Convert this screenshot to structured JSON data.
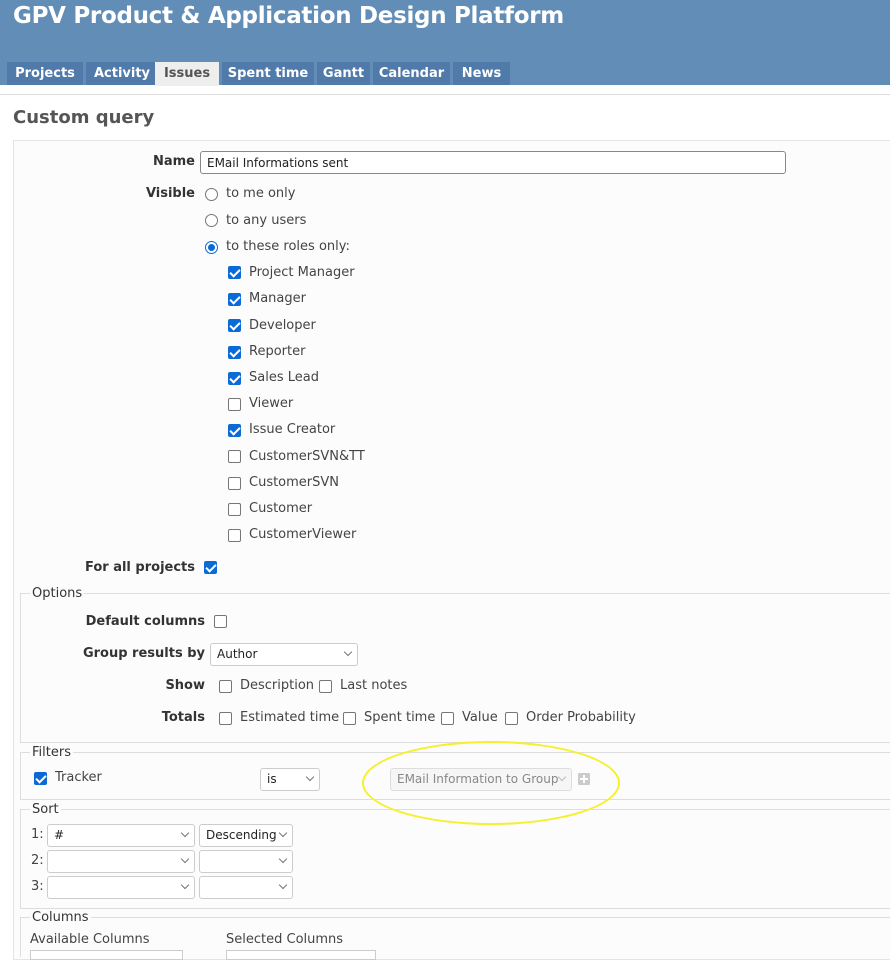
{
  "app": {
    "title": "GPV Product & Application Design Platform"
  },
  "menu": {
    "tabs": [
      {
        "label": "Projects"
      },
      {
        "label": "Activity"
      },
      {
        "label": "Issues",
        "selected": true
      },
      {
        "label": "Spent time"
      },
      {
        "label": "Gantt"
      },
      {
        "label": "Calendar"
      },
      {
        "label": "News"
      }
    ]
  },
  "page": {
    "title": "Custom query"
  },
  "form": {
    "name_label": "Name",
    "name_value": "EMail Informations sent",
    "visible_label": "Visible",
    "visibility_options": [
      {
        "label": "to me only",
        "checked": false
      },
      {
        "label": "to any users",
        "checked": false
      },
      {
        "label": "to these roles only:",
        "checked": true
      }
    ],
    "roles": [
      {
        "label": "Project Manager",
        "checked": true
      },
      {
        "label": "Manager",
        "checked": true
      },
      {
        "label": "Developer",
        "checked": true
      },
      {
        "label": "Reporter",
        "checked": true
      },
      {
        "label": "Sales Lead",
        "checked": true
      },
      {
        "label": "Viewer",
        "checked": false
      },
      {
        "label": "Issue Creator",
        "checked": true
      },
      {
        "label": "CustomerSVN&TT",
        "checked": false
      },
      {
        "label": "CustomerSVN",
        "checked": false
      },
      {
        "label": "Customer",
        "checked": false
      },
      {
        "label": "CustomerViewer",
        "checked": false
      }
    ],
    "all_projects_label": "For all projects",
    "all_projects_checked": true
  },
  "options": {
    "legend": "Options",
    "default_columns_label": "Default columns",
    "group_by_label": "Group results by",
    "group_by_value": "Author",
    "show_label": "Show",
    "show_items": [
      {
        "label": "Description"
      },
      {
        "label": "Last notes"
      }
    ],
    "totals_label": "Totals",
    "totals_items": [
      {
        "label": "Estimated time"
      },
      {
        "label": "Spent time"
      },
      {
        "label": "Value"
      },
      {
        "label": "Order Probability"
      }
    ]
  },
  "filters": {
    "legend": "Filters",
    "tracker_label": "Tracker",
    "operator": "is",
    "value": "EMail Information to Group"
  },
  "sort": {
    "legend": "Sort",
    "rows": [
      {
        "index": "1:",
        "field": "#",
        "order": "Descending"
      },
      {
        "index": "2:",
        "field": "",
        "order": ""
      },
      {
        "index": "3:",
        "field": "",
        "order": ""
      }
    ]
  },
  "columns": {
    "legend": "Columns",
    "available_label": "Available Columns",
    "selected_label": "Selected Columns"
  },
  "colors": {
    "header_bg": "#628db6",
    "tab_bg": "#507aaa",
    "checkbox_blue": "#0b6bd6",
    "highlight": "#f5f02a"
  }
}
